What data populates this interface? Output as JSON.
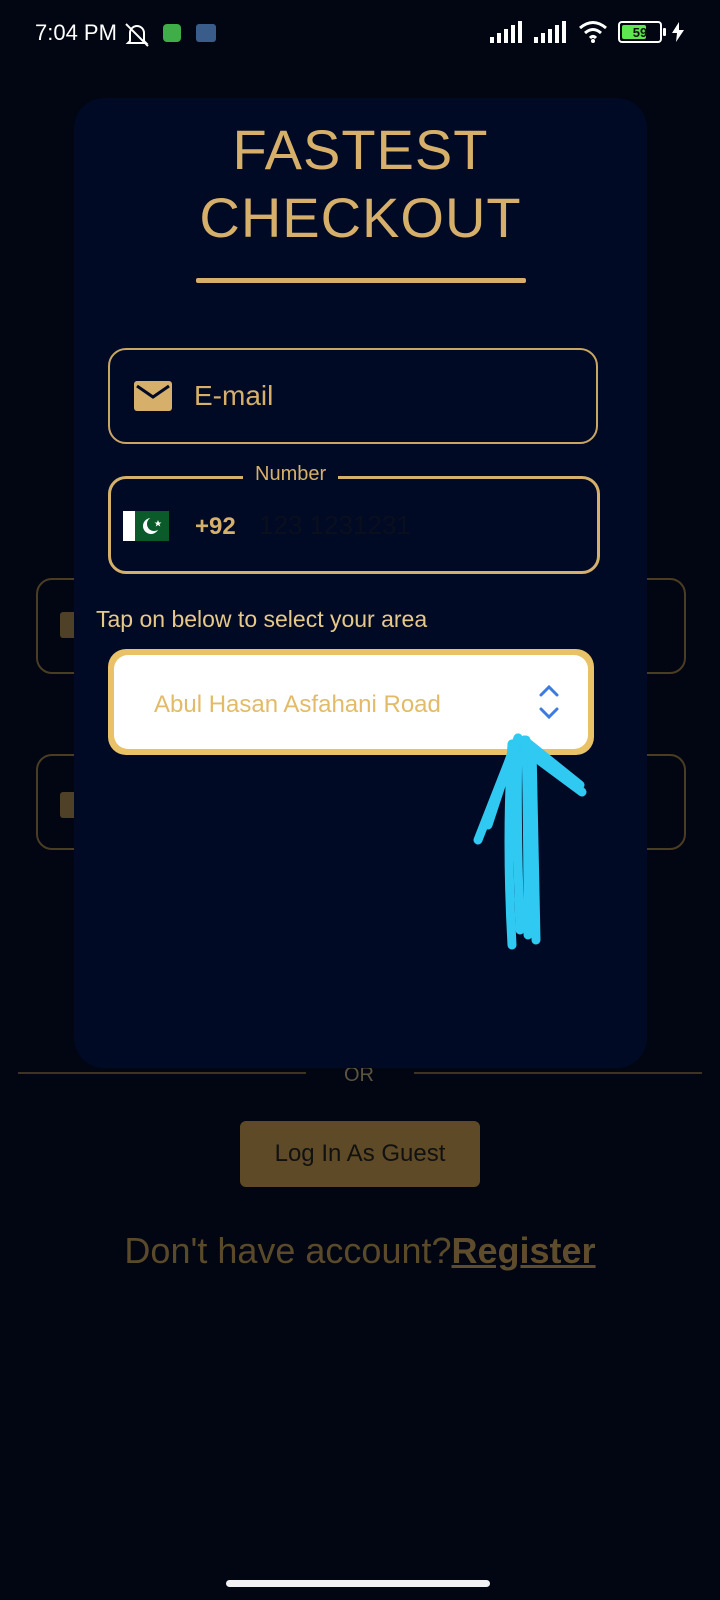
{
  "status_bar": {
    "time": "7:04 PM",
    "battery": "59"
  },
  "background_page": {
    "or_text": "OR",
    "guest_button_label": "Log In As Guest",
    "register_prompt": "Don't have account?",
    "register_link": "Register"
  },
  "modal": {
    "title_line1": "FASTEST",
    "title_line2": "CHECKOUT",
    "email_placeholder": "E-mail",
    "phone_label": "Number",
    "dial_code": "+92",
    "phone_placeholder": "123 1231231",
    "area_hint": "Tap on below to select your area",
    "area_selected": "Abul Hasan Asfahani Road"
  },
  "colors": {
    "gold": "#d6b06a",
    "modal_bg": "#010a25",
    "page_bg": "#010612",
    "annotation": "#2fc9f2"
  }
}
